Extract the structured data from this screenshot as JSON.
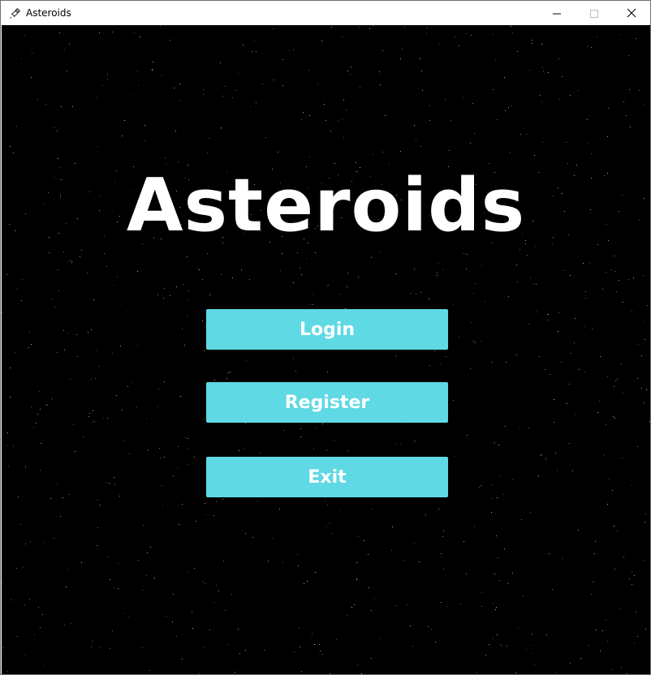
{
  "window": {
    "title": "Asteroids",
    "app_icon": "rocket-icon"
  },
  "controls": {
    "minimize_icon": "minimize-icon",
    "maximize_icon": "maximize-icon",
    "close_icon": "close-icon"
  },
  "game": {
    "title": "Asteroids"
  },
  "menu": {
    "login_label": "Login",
    "register_label": "Register",
    "exit_label": "Exit"
  },
  "colors": {
    "background": "#000000",
    "button": "#5fd9e4",
    "button_text": "#ffffff",
    "title_text": "#ffffff"
  }
}
